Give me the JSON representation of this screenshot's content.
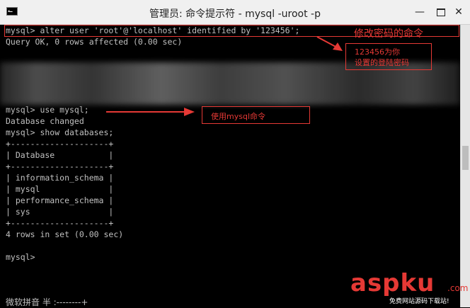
{
  "window": {
    "title": "管理员: 命令提示符 - mysql  -uroot -p",
    "icon": "console-icon",
    "min_label": "—",
    "close_label": "✕"
  },
  "console": {
    "lines": [
      "mysql> alter user 'root'@'localhost' identified by '123456';",
      "Query OK, 0 rows affected (0.00 sec)",
      "",
      "",
      "",
      "",
      "",
      "mysql> use mysql;",
      "Database changed",
      "mysql> show databases;",
      "+--------------------+",
      "| Database           |",
      "+--------------------+",
      "| information_schema |",
      "| mysql              |",
      "| performance_schema |",
      "| sys                |",
      "+--------------------+",
      "4 rows in set (0.00 sec)",
      "",
      "mysql>"
    ]
  },
  "annotations": {
    "cmd_label": "修改密码的命令",
    "password_note_line1": "123456为你",
    "password_note_line2": "设置的登陆密码",
    "use_mysql_note": "使用mysql命令"
  },
  "ime": {
    "status": "微软拼音 半 :--------+"
  },
  "watermark": {
    "brand_a": "asp",
    "brand_b": "ku",
    "brand_c": ".com",
    "subtitle": "免费网站源码下载站!"
  },
  "colors": {
    "annotation": "#e53935",
    "console_bg": "#000000",
    "console_text": "#c0c0c0"
  }
}
